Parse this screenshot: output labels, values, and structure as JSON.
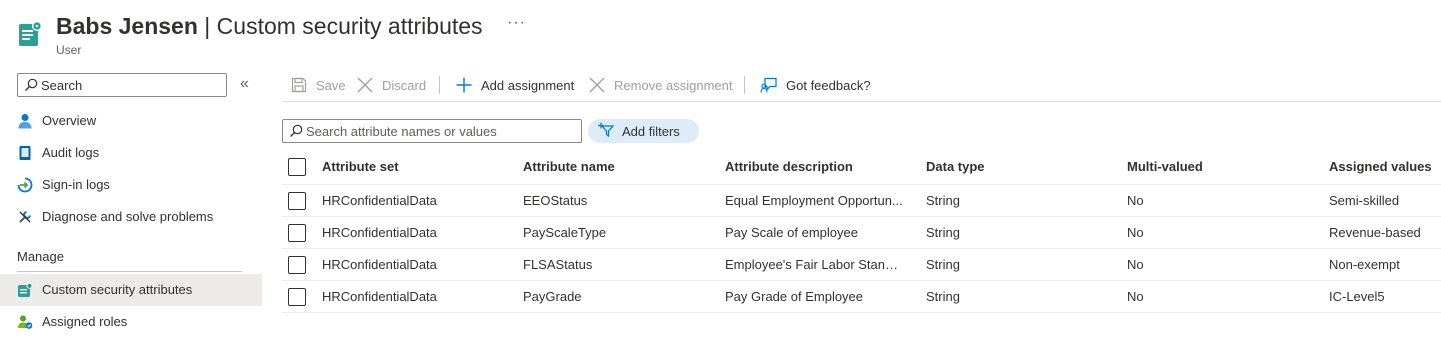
{
  "header": {
    "name": "Babs Jensen",
    "separator": " | ",
    "page": "Custom security attributes",
    "subtitle": "User",
    "more": "···",
    "icon": "custom-security-attributes-icon"
  },
  "sidebar": {
    "search_placeholder": "Search",
    "collapse": "«",
    "items": [
      {
        "label": "Overview",
        "icon": "user-icon"
      },
      {
        "label": "Audit logs",
        "icon": "audit-log-icon"
      },
      {
        "label": "Sign-in logs",
        "icon": "sign-in-icon"
      },
      {
        "label": "Diagnose and solve problems",
        "icon": "wrench-icon"
      }
    ],
    "section": "Manage",
    "manage_items": [
      {
        "label": "Custom security attributes",
        "icon": "custom-security-attributes-icon",
        "selected": true
      },
      {
        "label": "Assigned roles",
        "icon": "assigned-roles-icon"
      }
    ]
  },
  "toolbar": {
    "save": "Save",
    "discard": "Discard",
    "add_assignment": "Add assignment",
    "remove_assignment": "Remove assignment",
    "feedback": "Got feedback?"
  },
  "filter": {
    "search_placeholder": "Search attribute names or values",
    "add_filters": "Add filters"
  },
  "table": {
    "columns": [
      "Attribute set",
      "Attribute name",
      "Attribute description",
      "Data type",
      "Multi-valued",
      "Assigned values"
    ],
    "rows": [
      [
        "HRConfidentialData",
        "EEOStatus",
        "Equal Employment Opportun...",
        "String",
        "No",
        "Semi-skilled"
      ],
      [
        "HRConfidentialData",
        "PayScaleType",
        "Pay Scale of employee",
        "String",
        "No",
        "Revenue-based"
      ],
      [
        "HRConfidentialData",
        "FLSAStatus",
        "Employee's Fair Labor Standa...",
        "String",
        "No",
        "Non-exempt"
      ],
      [
        "HRConfidentialData",
        "PayGrade",
        "Pay Grade of Employee",
        "String",
        "No",
        "IC-Level5"
      ]
    ]
  },
  "colors": {
    "accent": "#0078d4",
    "teal": "#2aa198",
    "selected_bg": "#edebe9",
    "filter_pill": "#deecf9"
  }
}
